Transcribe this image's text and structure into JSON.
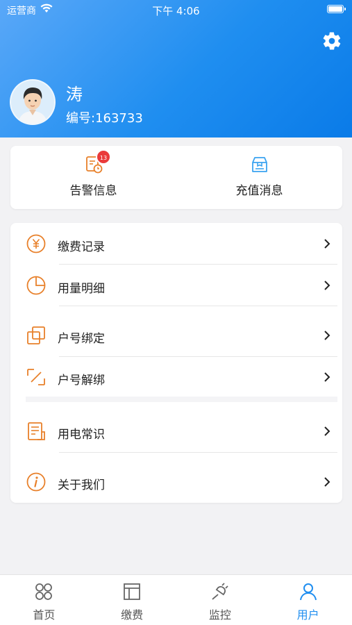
{
  "status_bar": {
    "carrier": "运营商",
    "time": "下午 4:06"
  },
  "profile": {
    "name": "涛",
    "id_text": "编号:163733"
  },
  "quick_actions": [
    {
      "label": "告警信息",
      "icon": "alarm-document-icon",
      "badge": "13"
    },
    {
      "label": "充值消息",
      "icon": "recharge-box-icon"
    }
  ],
  "menu": [
    {
      "label": "缴费记录",
      "icon": "yen-circle-icon"
    },
    {
      "label": "用量明细",
      "icon": "pie-chart-icon"
    },
    {
      "label": "户号绑定",
      "icon": "link-squares-icon"
    },
    {
      "label": "户号解绑",
      "icon": "unlink-icon"
    },
    {
      "label": "用电常识",
      "icon": "document-list-icon"
    },
    {
      "label": "关于我们",
      "icon": "info-circle-icon"
    }
  ],
  "tabs": [
    {
      "label": "首页",
      "icon": "home-grid-icon",
      "active": false
    },
    {
      "label": "缴费",
      "icon": "layout-panel-icon",
      "active": false
    },
    {
      "label": "监控",
      "icon": "plug-icon",
      "active": false
    },
    {
      "label": "用户",
      "icon": "user-icon",
      "active": true
    }
  ],
  "colors": {
    "accent": "#1f8ef0",
    "menu_icon": "#e8802a",
    "badge": "#ea3a3a"
  }
}
